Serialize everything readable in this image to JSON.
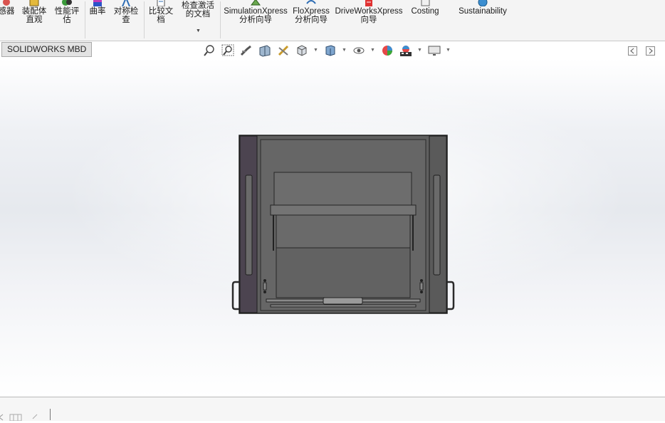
{
  "ribbon": {
    "items": [
      {
        "label": "感器"
      },
      {
        "label": "装配体\n直观"
      },
      {
        "label": "性能评\n估"
      },
      {
        "label": "曲率"
      },
      {
        "label": "对称检\n查"
      },
      {
        "label": "比较文\n档"
      },
      {
        "label": "检查激活\n的文档"
      },
      {
        "label": "SimulationXpress\n分析向导"
      },
      {
        "label": "FloXpress\n分析向导"
      },
      {
        "label": "DriveWorksXpress\n向导"
      },
      {
        "label": "Costing"
      },
      {
        "label": "Sustainability"
      }
    ]
  },
  "tabs": {
    "mbd_label": "SOLIDWORKS MBD"
  },
  "heads_up_toolbar": {
    "icons": [
      "zoom-to-fit-icon",
      "zoom-to-area-icon",
      "previous-view-icon",
      "section-view-icon",
      "dynamic-annotation-icon",
      "view-orientation-icon",
      "display-style-icon",
      "hide-show-items-icon",
      "edit-appearance-icon",
      "apply-scene-icon",
      "view-settings-icon"
    ]
  },
  "colors": {
    "accent": "#2e6db4",
    "model_fill": "#6a6a6a",
    "model_edge": "#2a2a2a",
    "ribbon_bg": "#f4f4f4"
  }
}
